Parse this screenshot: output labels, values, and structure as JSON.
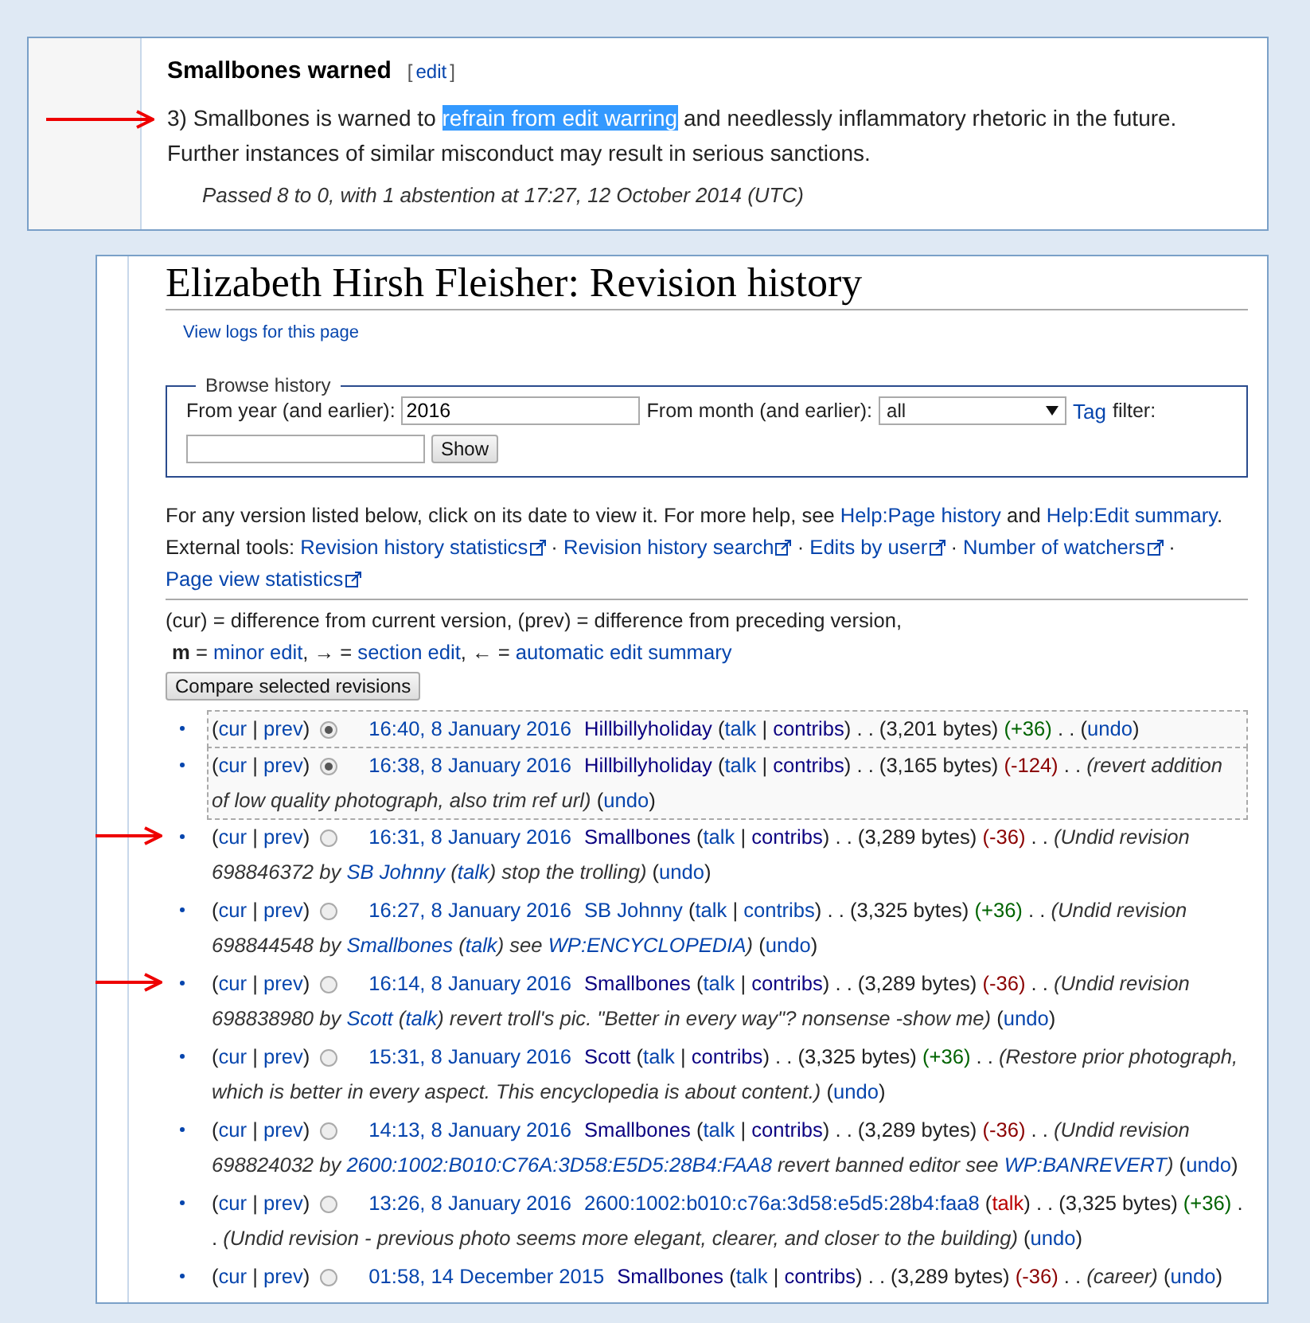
{
  "decision": {
    "heading": "Smallbones warned",
    "edit_open": "[",
    "edit_link": "edit",
    "edit_close": "]",
    "arrow": true,
    "paragraph": [
      {
        "text": "3) Smallbones is warned to ",
        "highlighted": false
      },
      {
        "text": "refrain from edit warring",
        "highlighted": true
      },
      {
        "text": " and needlessly inflammatory rhetoric in the future. Further instances of similar misconduct may result in serious sanctions.",
        "highlighted": false
      }
    ],
    "passed": "Passed 8 to 0, with 1 abstention at 17:27, 12 October 2014 (UTC)"
  },
  "history": {
    "title": "Elizabeth Hirsh Fleisher: Revision history",
    "logs_link": "View logs for this page",
    "browse": {
      "legend": "Browse history",
      "year_label": "From year (and earlier):",
      "year_value": "2016",
      "month_label": "From month (and earlier):",
      "month_value": "all",
      "tag_link": "Tag",
      "tag_label": "filter:",
      "show_button": "Show"
    },
    "help": [
      {
        "text": "For any version listed below, click on its date to view it. For more help, see ",
        "kind": "p"
      },
      {
        "text": "Help:Page history",
        "kind": "l"
      },
      {
        "text": " and ",
        "kind": "p"
      },
      {
        "text": "Help:Edit summary",
        "kind": "l"
      },
      {
        "text": ".",
        "kind": "p"
      }
    ],
    "tools": [
      {
        "text": "External tools: ",
        "kind": "p"
      },
      {
        "text": "Revision history statistics",
        "kind": "x"
      },
      {
        "text": " · ",
        "kind": "p"
      },
      {
        "text": "Revision history search",
        "kind": "x"
      },
      {
        "text": " · ",
        "kind": "p"
      },
      {
        "text": "Edits by user",
        "kind": "x"
      },
      {
        "text": " · ",
        "kind": "p"
      },
      {
        "text": "Number of watchers",
        "kind": "x"
      },
      {
        "text": " · ",
        "kind": "p"
      },
      {
        "text": "Page view statistics",
        "kind": "x"
      }
    ],
    "legend_line1": "(cur) = difference from current version, (prev) = difference from preceding version,",
    "legend_line2": [
      {
        "text": "**m** = ",
        "kind": "p"
      },
      {
        "text": "minor edit",
        "kind": "l"
      },
      {
        "text": ", → = ",
        "kind": "p"
      },
      {
        "text": "section edit",
        "kind": "l"
      },
      {
        "text": ", ← = ",
        "kind": "p"
      },
      {
        "text": "automatic edit summary",
        "kind": "l"
      }
    ],
    "compare_button": "Compare selected revisions",
    "revisions": [
      {
        "selected": true,
        "arrow": false,
        "lead": [
          {
            "text": "(",
            "kind": "p"
          },
          {
            "text": "cur",
            "kind": "l"
          },
          {
            "text": " | ",
            "kind": "p"
          },
          {
            "text": "prev",
            "kind": "l"
          },
          {
            "text": ")",
            "kind": "p"
          }
        ],
        "rest": [
          {
            "text": "16:40, 8 January 2016",
            "kind": "d"
          },
          {
            "text": "Hillbillyholiday",
            "kind": "u"
          },
          {
            "text": " (",
            "kind": "p"
          },
          {
            "text": "talk",
            "kind": "l"
          },
          {
            "text": " | ",
            "kind": "p"
          },
          {
            "text": "contribs",
            "kind": "u"
          },
          {
            "text": ") . . (3,201 bytes) ",
            "kind": "p"
          },
          {
            "text": "(+36)",
            "kind": "plus"
          },
          {
            "text": " . . (",
            "kind": "p"
          },
          {
            "text": "undo",
            "kind": "l"
          },
          {
            "text": ")",
            "kind": "p"
          }
        ]
      },
      {
        "selected": true,
        "arrow": false,
        "lead": [
          {
            "text": "(",
            "kind": "p"
          },
          {
            "text": "cur",
            "kind": "l"
          },
          {
            "text": " | ",
            "kind": "p"
          },
          {
            "text": "prev",
            "kind": "l"
          },
          {
            "text": ")",
            "kind": "p"
          }
        ],
        "rest": [
          {
            "text": "16:38, 8 January 2016",
            "kind": "d"
          },
          {
            "text": "Hillbillyholiday",
            "kind": "u"
          },
          {
            "text": " (",
            "kind": "p"
          },
          {
            "text": "talk",
            "kind": "l"
          },
          {
            "text": " | ",
            "kind": "p"
          },
          {
            "text": "contribs",
            "kind": "u"
          },
          {
            "text": ") . . (3,165 bytes) ",
            "kind": "p"
          },
          {
            "text": "(-124)",
            "kind": "minus"
          },
          {
            "text": " . . ",
            "kind": "p"
          },
          {
            "text": "(revert addition of low quality photograph, also trim ref url)",
            "kind": "i"
          },
          {
            "text": " (",
            "kind": "p"
          },
          {
            "text": "undo",
            "kind": "l"
          },
          {
            "text": ")",
            "kind": "p"
          }
        ]
      },
      {
        "selected": false,
        "arrow": true,
        "lead": [
          {
            "text": "(",
            "kind": "p"
          },
          {
            "text": "cur",
            "kind": "l"
          },
          {
            "text": " | ",
            "kind": "p"
          },
          {
            "text": "prev",
            "kind": "l"
          },
          {
            "text": ")",
            "kind": "p"
          }
        ],
        "rest": [
          {
            "text": "16:31, 8 January 2016",
            "kind": "d"
          },
          {
            "text": "Smallbones",
            "kind": "u"
          },
          {
            "text": " (",
            "kind": "p"
          },
          {
            "text": "talk",
            "kind": "l"
          },
          {
            "text": " | ",
            "kind": "p"
          },
          {
            "text": "contribs",
            "kind": "u"
          },
          {
            "text": ") . . (3,289 bytes) ",
            "kind": "p"
          },
          {
            "text": "(-36)",
            "kind": "minus"
          },
          {
            "text": " . . ",
            "kind": "p"
          },
          {
            "text": "(Undid revision 698846372 by ",
            "kind": "i"
          },
          {
            "text": "SB Johnny",
            "kind": "il"
          },
          {
            "text": " (",
            "kind": "i"
          },
          {
            "text": "talk",
            "kind": "il"
          },
          {
            "text": ") stop the trolling)",
            "kind": "i"
          },
          {
            "text": " (",
            "kind": "p"
          },
          {
            "text": "undo",
            "kind": "l"
          },
          {
            "text": ")",
            "kind": "p"
          }
        ]
      },
      {
        "selected": false,
        "arrow": false,
        "lead": [
          {
            "text": "(",
            "kind": "p"
          },
          {
            "text": "cur",
            "kind": "l"
          },
          {
            "text": " | ",
            "kind": "p"
          },
          {
            "text": "prev",
            "kind": "l"
          },
          {
            "text": ")",
            "kind": "p"
          }
        ],
        "rest": [
          {
            "text": "16:27, 8 January 2016",
            "kind": "d"
          },
          {
            "text": "SB Johnny",
            "kind": "l"
          },
          {
            "text": " (",
            "kind": "p"
          },
          {
            "text": "talk",
            "kind": "l"
          },
          {
            "text": " | ",
            "kind": "p"
          },
          {
            "text": "contribs",
            "kind": "l"
          },
          {
            "text": ") . . (3,325 bytes) ",
            "kind": "p"
          },
          {
            "text": "(+36)",
            "kind": "plus"
          },
          {
            "text": " . . ",
            "kind": "p"
          },
          {
            "text": "(Undid revision 698844548 by ",
            "kind": "i"
          },
          {
            "text": "Smallbones",
            "kind": "il"
          },
          {
            "text": " (",
            "kind": "i"
          },
          {
            "text": "talk",
            "kind": "il"
          },
          {
            "text": ") see ",
            "kind": "i"
          },
          {
            "text": "WP:ENCYCLOPEDIA",
            "kind": "il"
          },
          {
            "text": ")",
            "kind": "i"
          },
          {
            "text": " (",
            "kind": "p"
          },
          {
            "text": "undo",
            "kind": "l"
          },
          {
            "text": ")",
            "kind": "p"
          }
        ]
      },
      {
        "selected": false,
        "arrow": true,
        "lead": [
          {
            "text": "(",
            "kind": "p"
          },
          {
            "text": "cur",
            "kind": "l"
          },
          {
            "text": " | ",
            "kind": "p"
          },
          {
            "text": "prev",
            "kind": "l"
          },
          {
            "text": ")",
            "kind": "p"
          }
        ],
        "rest": [
          {
            "text": "16:14, 8 January 2016",
            "kind": "d"
          },
          {
            "text": "Smallbones",
            "kind": "u"
          },
          {
            "text": " (",
            "kind": "p"
          },
          {
            "text": "talk",
            "kind": "l"
          },
          {
            "text": " | ",
            "kind": "p"
          },
          {
            "text": "contribs",
            "kind": "u"
          },
          {
            "text": ") . . (3,289 bytes) ",
            "kind": "p"
          },
          {
            "text": "(-36)",
            "kind": "minus"
          },
          {
            "text": " . . ",
            "kind": "p"
          },
          {
            "text": "(Undid revision 698838980 by ",
            "kind": "i"
          },
          {
            "text": "Scott",
            "kind": "il"
          },
          {
            "text": " (",
            "kind": "i"
          },
          {
            "text": "talk",
            "kind": "il"
          },
          {
            "text": ") revert troll's pic. \"Better in every way\"? nonsense -show me)",
            "kind": "i"
          },
          {
            "text": " (",
            "kind": "p"
          },
          {
            "text": "undo",
            "kind": "l"
          },
          {
            "text": ")",
            "kind": "p"
          }
        ]
      },
      {
        "selected": false,
        "arrow": false,
        "lead": [
          {
            "text": "(",
            "kind": "p"
          },
          {
            "text": "cur",
            "kind": "l"
          },
          {
            "text": " | ",
            "kind": "p"
          },
          {
            "text": "prev",
            "kind": "l"
          },
          {
            "text": ")",
            "kind": "p"
          }
        ],
        "rest": [
          {
            "text": "15:31, 8 January 2016",
            "kind": "d"
          },
          {
            "text": "Scott",
            "kind": "u"
          },
          {
            "text": " (",
            "kind": "p"
          },
          {
            "text": "talk",
            "kind": "l"
          },
          {
            "text": " | ",
            "kind": "p"
          },
          {
            "text": "contribs",
            "kind": "u"
          },
          {
            "text": ") . . (3,325 bytes) ",
            "kind": "p"
          },
          {
            "text": "(+36)",
            "kind": "plus"
          },
          {
            "text": " . . ",
            "kind": "p"
          },
          {
            "text": "(Restore prior photograph, which is better in every aspect. This encyclopedia is about content.)",
            "kind": "i"
          },
          {
            "text": " (",
            "kind": "p"
          },
          {
            "text": "undo",
            "kind": "l"
          },
          {
            "text": ")",
            "kind": "p"
          }
        ]
      },
      {
        "selected": false,
        "arrow": false,
        "lead": [
          {
            "text": "(",
            "kind": "p"
          },
          {
            "text": "cur",
            "kind": "l"
          },
          {
            "text": " | ",
            "kind": "p"
          },
          {
            "text": "prev",
            "kind": "l"
          },
          {
            "text": ")",
            "kind": "p"
          }
        ],
        "rest": [
          {
            "text": "14:13, 8 January 2016",
            "kind": "d"
          },
          {
            "text": "Smallbones",
            "kind": "u"
          },
          {
            "text": " (",
            "kind": "p"
          },
          {
            "text": "talk",
            "kind": "l"
          },
          {
            "text": " | ",
            "kind": "p"
          },
          {
            "text": "contribs",
            "kind": "u"
          },
          {
            "text": ") . . (3,289 bytes) ",
            "kind": "p"
          },
          {
            "text": "(-36)",
            "kind": "minus"
          },
          {
            "text": " . . ",
            "kind": "p"
          },
          {
            "text": "(Undid revision 698824032 by ",
            "kind": "i"
          },
          {
            "text": "2600:1002:B010:C76A:3D58:E5D5:28B4:FAA8",
            "kind": "il"
          },
          {
            "text": " revert banned editor see ",
            "kind": "i"
          },
          {
            "text": "WP:BANREVERT",
            "kind": "il"
          },
          {
            "text": ")",
            "kind": "i"
          },
          {
            "text": " (",
            "kind": "p"
          },
          {
            "text": "undo",
            "kind": "l"
          },
          {
            "text": ")",
            "kind": "p"
          }
        ]
      },
      {
        "selected": false,
        "arrow": false,
        "lead": [
          {
            "text": "(",
            "kind": "p"
          },
          {
            "text": "cur",
            "kind": "l"
          },
          {
            "text": " | ",
            "kind": "p"
          },
          {
            "text": "prev",
            "kind": "l"
          },
          {
            "text": ")",
            "kind": "p"
          }
        ],
        "rest": [
          {
            "text": "13:26, 8 January 2016",
            "kind": "d"
          },
          {
            "text": "2600:1002:b010:c76a:3d58:e5d5:28b4:faa8",
            "kind": "l"
          },
          {
            "text": " (",
            "kind": "p"
          },
          {
            "text": "talk",
            "kind": "r"
          },
          {
            "text": ") . . (3,325 bytes) ",
            "kind": "p"
          },
          {
            "text": "(+36)",
            "kind": "plus"
          },
          {
            "text": " . . ",
            "kind": "p"
          },
          {
            "text": "(Undid revision - previous photo seems more elegant, clearer, and closer to the building)",
            "kind": "i"
          },
          {
            "text": " (",
            "kind": "p"
          },
          {
            "text": "undo",
            "kind": "l"
          },
          {
            "text": ")",
            "kind": "p"
          }
        ]
      },
      {
        "selected": false,
        "arrow": false,
        "lead": [
          {
            "text": "(",
            "kind": "p"
          },
          {
            "text": "cur",
            "kind": "l"
          },
          {
            "text": " | ",
            "kind": "p"
          },
          {
            "text": "prev",
            "kind": "l"
          },
          {
            "text": ")",
            "kind": "p"
          }
        ],
        "rest": [
          {
            "text": "01:58, 14 December 2015",
            "kind": "d"
          },
          {
            "text": "Smallbones",
            "kind": "u"
          },
          {
            "text": " (",
            "kind": "p"
          },
          {
            "text": "talk",
            "kind": "l"
          },
          {
            "text": " | ",
            "kind": "p"
          },
          {
            "text": "contribs",
            "kind": "u"
          },
          {
            "text": ") . . (3,289 bytes) ",
            "kind": "p"
          },
          {
            "text": "(-36)",
            "kind": "minus"
          },
          {
            "text": " . . ",
            "kind": "p"
          },
          {
            "text": "(career)",
            "kind": "i"
          },
          {
            "text": " (",
            "kind": "p"
          },
          {
            "text": "undo",
            "kind": "l"
          },
          {
            "text": ")",
            "kind": "p"
          }
        ]
      }
    ]
  }
}
